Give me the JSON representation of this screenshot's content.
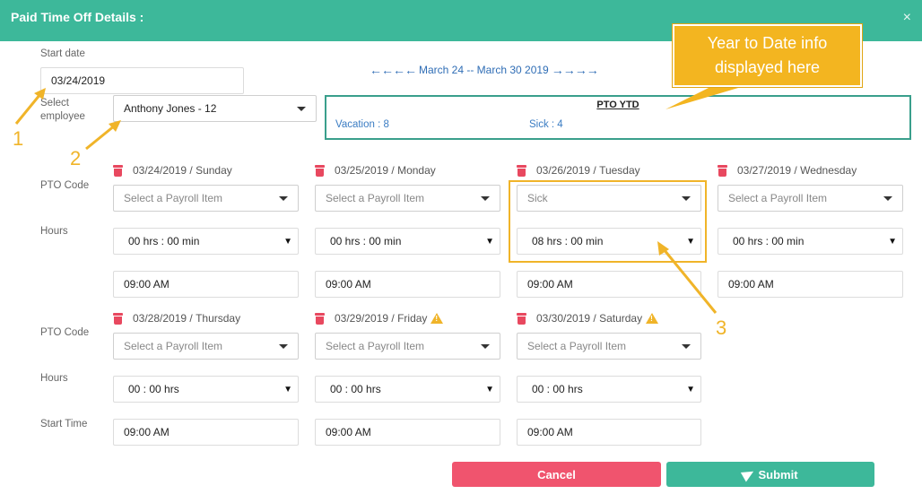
{
  "header": {
    "title": "Paid Time Off Details :",
    "close_glyph": "×"
  },
  "labels": {
    "start_date": "Start date",
    "select_employee": "Select employee",
    "pto_code": "PTO Code",
    "hours": "Hours",
    "start_time": "Start Time"
  },
  "start_date": {
    "value": "03/24/2019"
  },
  "employee": {
    "value": "Anthony Jones - 12"
  },
  "week_nav": {
    "prev_arrows": "🡐🡐🡐🡐",
    "range": "March 24 -- March 30 2019",
    "next_arrows": "🡒🡒🡒🡒"
  },
  "ytd": {
    "title": "PTO YTD",
    "vacation": "Vacation : 8",
    "sick": "Sick : 4"
  },
  "callout": {
    "text": "Year to Date info displayed here"
  },
  "days": [
    {
      "date": "03/24/2019",
      "day": "Sunday",
      "pto": "Select a Payroll Item",
      "hours": "00 hrs : 00 min",
      "start": "09:00 AM",
      "warning": false
    },
    {
      "date": "03/25/2019",
      "day": "Monday",
      "pto": "Select a Payroll Item",
      "hours": "00 hrs : 00 min",
      "start": "09:00 AM",
      "warning": false
    },
    {
      "date": "03/26/2019",
      "day": "Tuesday",
      "pto": "Sick",
      "hours": "08 hrs : 00 min",
      "start": "09:00 AM",
      "warning": false
    },
    {
      "date": "03/27/2019",
      "day": "Wednesday",
      "pto": "Select a Payroll Item",
      "hours": "00 hrs : 00 min",
      "start": "09:00 AM",
      "warning": false
    },
    {
      "date": "03/28/2019",
      "day": "Thursday",
      "pto": "Select a Payroll Item",
      "hours": "00 : 00 hrs",
      "start": "09:00 AM",
      "warning": false
    },
    {
      "date": "03/29/2019",
      "day": "Friday",
      "pto": "Select a Payroll Item",
      "hours": "00 : 00 hrs",
      "start": "09:00 AM",
      "warning": true
    },
    {
      "date": "03/30/2019",
      "day": "Saturday",
      "pto": "Select a Payroll Item",
      "hours": "00 : 00 hrs",
      "start": "09:00 AM",
      "warning": true
    }
  ],
  "buttons": {
    "cancel": "Cancel",
    "submit": "Submit"
  },
  "annotations": {
    "n1": "1",
    "n2": "2",
    "n3": "3"
  },
  "colors": {
    "header": "#3db89a",
    "cancel": "#f0546e",
    "submit": "#3db89a",
    "accent": "#f0b429",
    "link": "#2f6db5"
  }
}
